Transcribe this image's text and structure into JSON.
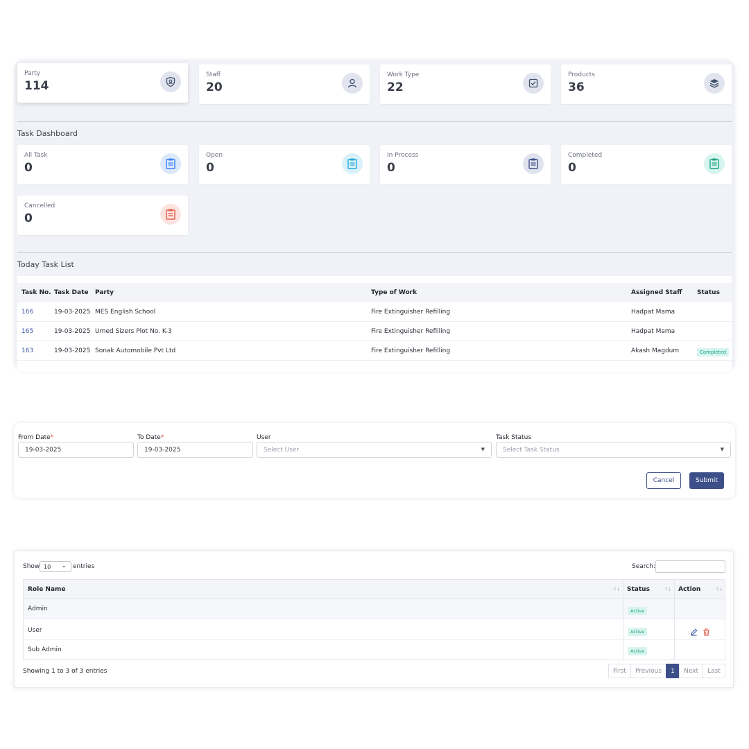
{
  "stats": [
    {
      "label": "Party",
      "value": "114",
      "icon": "shield-user-icon"
    },
    {
      "label": "Staff",
      "value": "20",
      "icon": "user-icon"
    },
    {
      "label": "Work Type",
      "value": "22",
      "icon": "checkbox-icon"
    },
    {
      "label": "Products",
      "value": "36",
      "icon": "layers-icon"
    }
  ],
  "task_dashboard": {
    "title": "Task Dashboard",
    "cards": [
      {
        "label": "All Task",
        "value": "0",
        "color": "#3b82f6"
      },
      {
        "label": "Open",
        "value": "0",
        "color": "#22a8d8"
      },
      {
        "label": "In Process",
        "value": "0",
        "color": "#3d4f89"
      },
      {
        "label": "Completed",
        "value": "0",
        "color": "#1ba384"
      },
      {
        "label": "Cancelled",
        "value": "0",
        "color": "#e35d4a"
      }
    ]
  },
  "today_tasks": {
    "title": "Today Task List",
    "headers": [
      "Task No.",
      "Task Date",
      "Party",
      "Type of Work",
      "Assigned Staff",
      "Status"
    ],
    "rows": [
      {
        "no": "166",
        "date": "19-03-2025",
        "party": "MES English School",
        "work": "Fire Extinguisher Refilling",
        "staff": "Hadpat Mama",
        "status": ""
      },
      {
        "no": "165",
        "date": "19-03-2025",
        "party": "Umed Sizers Plot No. K-3",
        "work": "Fire Extinguisher Refilling",
        "staff": "Hadpat Mama",
        "status": ""
      },
      {
        "no": "163",
        "date": "19-03-2025",
        "party": "Sonak Automobile Pvt Ltd",
        "work": "Fire Extinguisher Refilling",
        "staff": "Akash Magdum",
        "status": "Completed"
      }
    ]
  },
  "filter": {
    "from_date_label": "From Date",
    "from_date_value": "19-03-2025",
    "to_date_label": "To Date",
    "to_date_value": "19-03-2025",
    "user_label": "User",
    "user_placeholder": "Select User",
    "status_label": "Task Status",
    "status_placeholder": "Select Task Status",
    "required_mark": "*",
    "cancel": "Cancel",
    "submit": "Submit"
  },
  "roles": {
    "show_label": "Show",
    "page_size": "10",
    "entries_label": "entries",
    "search_label": "Search:",
    "headers": [
      "Role Name",
      "Status",
      "Action"
    ],
    "rows": [
      {
        "name": "Admin",
        "status": "Active"
      },
      {
        "name": "User",
        "status": "Active"
      },
      {
        "name": "Sub Admin",
        "status": "Active"
      }
    ],
    "info": "Showing 1 to 3 of 3 entries",
    "pager": [
      "First",
      "Previous",
      "1",
      "Next",
      "Last"
    ]
  }
}
